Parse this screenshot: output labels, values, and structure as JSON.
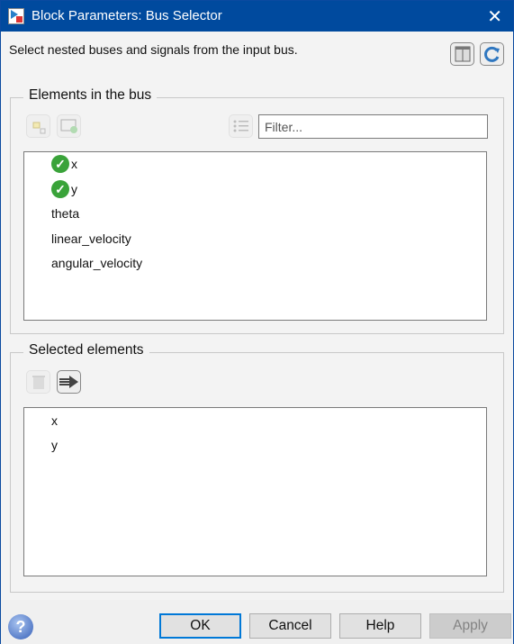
{
  "window": {
    "title": "Block Parameters: Bus Selector",
    "close_icon": "close-icon"
  },
  "description": "Select nested buses and signals from the input bus.",
  "elements_group": {
    "legend": "Elements in the bus",
    "filter": {
      "placeholder": "Filter...",
      "value": ""
    },
    "items": [
      {
        "label": "x",
        "selected": true
      },
      {
        "label": "y",
        "selected": true
      },
      {
        "label": "theta",
        "selected": false
      },
      {
        "label": "linear_velocity",
        "selected": false
      },
      {
        "label": "angular_velocity",
        "selected": false
      }
    ]
  },
  "selected_group": {
    "legend": "Selected elements",
    "items": [
      {
        "label": "x"
      },
      {
        "label": "y"
      }
    ]
  },
  "buttons": {
    "ok": "OK",
    "cancel": "Cancel",
    "help": "Help",
    "apply": "Apply"
  },
  "colors": {
    "titlebar": "#004a9e",
    "check": "#3aa33a",
    "default_button_border": "#0078d7"
  }
}
